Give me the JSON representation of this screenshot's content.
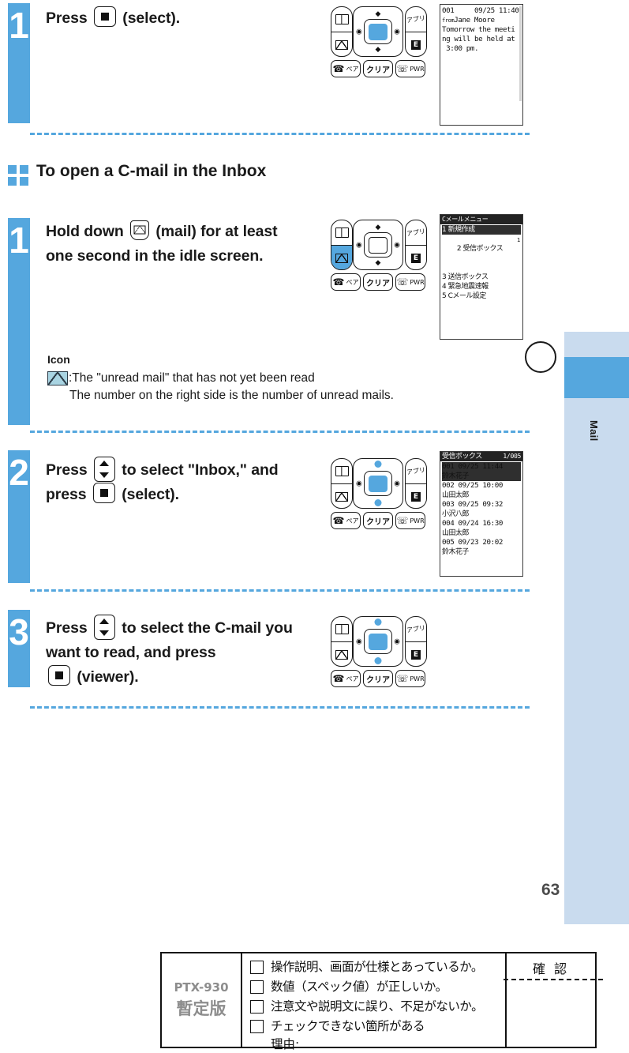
{
  "document": {
    "page_number": "63",
    "side_tab_label": "Mail"
  },
  "section": {
    "title": "To open a C-mail in the Inbox",
    "icon": "four-squares-icon"
  },
  "steps": [
    {
      "number": "1",
      "lines": [
        "Press {key-center} (select)."
      ],
      "line1_pre": "Press",
      "line1_post": "(select).",
      "keypad": {
        "book_key": "book-icon",
        "mail_key": "mail-icon",
        "appli_label": "アプリ",
        "ez_label": "E",
        "call_label": "ペア",
        "clear_label": "クリア",
        "power_label": "PWR",
        "highlight": "center"
      },
      "screen": {
        "type": "cmail-viewer",
        "header": "001     09/25 11:40",
        "from_prefix": "from",
        "from_name": "Jane Moore",
        "body": [
          "Tomorrow the meeti",
          "ng will be held at",
          " 3:00 pm."
        ]
      }
    },
    {
      "number": "1",
      "line1_pre": "Hold down",
      "line1_post": "(mail) for at least",
      "line2": "one second in the idle screen.",
      "keypad": {
        "highlight": "mail"
      },
      "screen": {
        "type": "cmail-menu",
        "title": "Cメールメニュー",
        "items": [
          "1 新規作成",
          "2 受信ボックス",
          "3 送信ボックス",
          "4 緊急地震速報",
          "5 Cメール設定"
        ],
        "selected_index": 0,
        "unread_badge": "1"
      },
      "note": {
        "title": "Icon",
        "icon": "envelope-icon",
        "line1": ":The \"unread mail\" that has not yet been read",
        "line2": "The number on the right side is the number of unread mails."
      }
    },
    {
      "number": "2",
      "line1_pre": "Press",
      "line1_post": "to select \"Inbox,\" and",
      "line2_pre": "press",
      "line2_post": "(select).",
      "keypad": {
        "highlight": "updown-center"
      },
      "screen": {
        "type": "inbox-list",
        "title": "受信ボックス",
        "counter": "1/005",
        "rows": [
          {
            "no": "001",
            "date": "09/25",
            "time": "11:44",
            "name": "鈴木花子",
            "selected": true
          },
          {
            "no": "002",
            "date": "09/25",
            "time": "10:00",
            "name": "山田太郎",
            "selected": false
          },
          {
            "no": "003",
            "date": "09/25",
            "time": "09:32",
            "name": "小沢八郎",
            "selected": false
          },
          {
            "no": "004",
            "date": "09/24",
            "time": "16:30",
            "name": "山田太郎",
            "selected": false
          },
          {
            "no": "005",
            "date": "09/23",
            "time": "20:02",
            "name": "鈴木花子",
            "selected": false
          }
        ]
      }
    },
    {
      "number": "3",
      "line1_pre": "Press",
      "line1_post": "to select the C-mail you",
      "line2": "want to read, and press",
      "line3_post": "(viewer).",
      "keypad": {
        "highlight": "updown-center"
      }
    }
  ],
  "keypad_common": {
    "book_icon": "book-icon",
    "mail_icon": "mail-icon",
    "appli_label": "アプリ",
    "ez_label": "E",
    "call_kana": "ペア",
    "clear_label": "クリア",
    "power_label": "PWR"
  },
  "stamp": {
    "model": "PTX-930",
    "version": "暫定版",
    "items": [
      "操作説明、画面が仕様とあっているか。",
      "数値（スペック値）が正しいか。",
      "注意文や説明文に誤り、不足がないか。",
      "チェックできない箇所がある"
    ],
    "reason_label": "理由:",
    "confirm_label": "確 認"
  },
  "colors": {
    "accent": "#55a7de",
    "side_band": "#c9dbee",
    "text": "#1a1a1a"
  }
}
